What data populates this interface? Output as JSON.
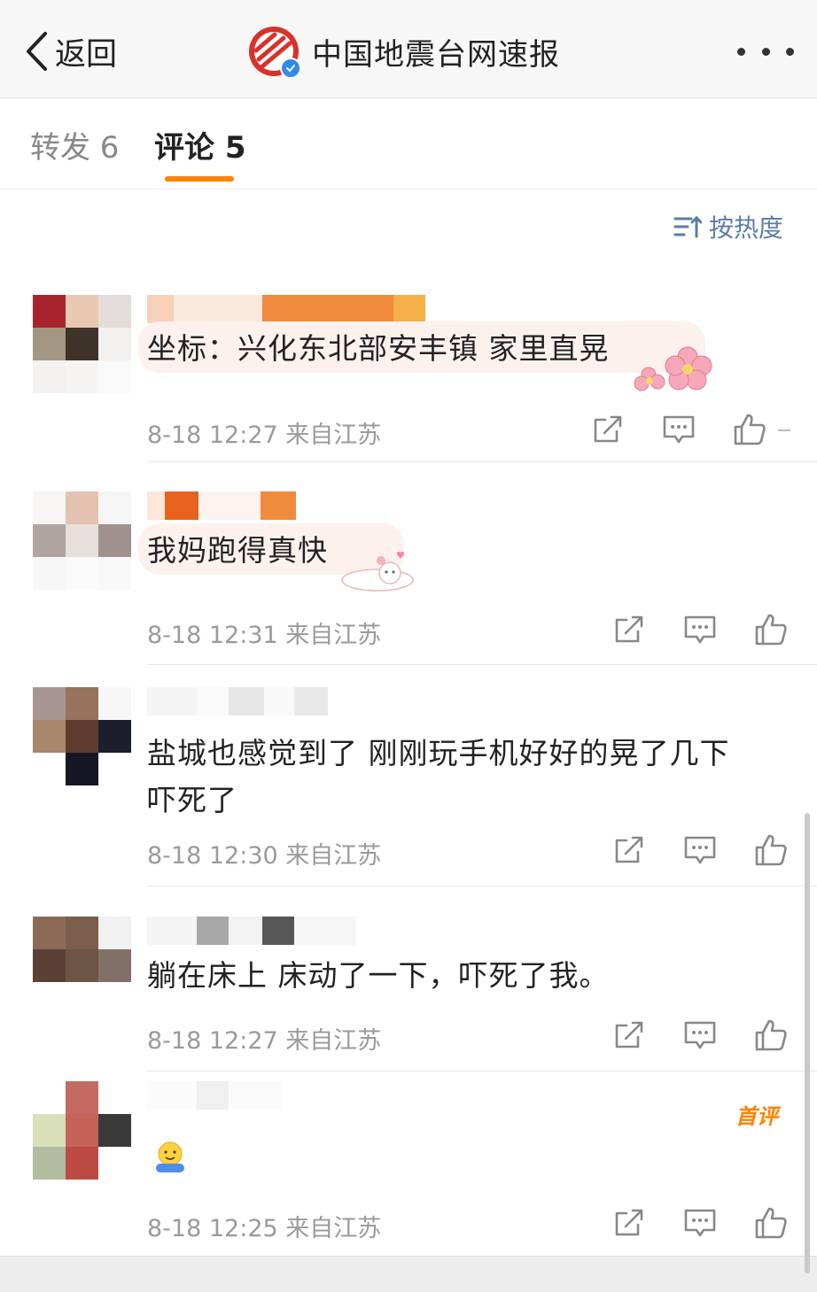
{
  "nav": {
    "back_label": "返回",
    "title": "中国地震台网速报",
    "logo_icon": "seismic-network-logo",
    "verified_icon": "verified-badge-icon",
    "more_icon": "more-dots-icon"
  },
  "tabs": {
    "forward_label": "转发 6",
    "comments_label": "评论 5",
    "active": "comments",
    "accent": "#ff8200"
  },
  "sort": {
    "label": "按热度",
    "icon": "sort-icon"
  },
  "comments": [
    {
      "text": "坐标：兴化东北部安丰镇 家里直晃",
      "meta": "8-18 12:27 来自江苏",
      "decoration": "flower-sticker"
    },
    {
      "text": "我妈跑得真快",
      "meta": "8-18 12:31 来自江苏",
      "decoration": "cat-sticker"
    },
    {
      "text": "盐城也感觉到了 刚刚玩手机好好的晃了几下",
      "text2": "吓死了",
      "meta": "8-18 12:30 来自江苏"
    },
    {
      "text": "躺在床上 床动了一下，吓死了我。",
      "meta": "8-18 12:27 来自江苏"
    },
    {
      "text": "",
      "emoji": "hug-emoji",
      "meta": "8-18 12:25 来自江苏",
      "badge": "首评"
    }
  ],
  "action_icons": [
    "share-icon",
    "reply-icon",
    "like-icon"
  ],
  "colors": {
    "meta": "#9a9a9a",
    "sort": "#5b7ca8",
    "username_orange": "#f08a3c"
  }
}
